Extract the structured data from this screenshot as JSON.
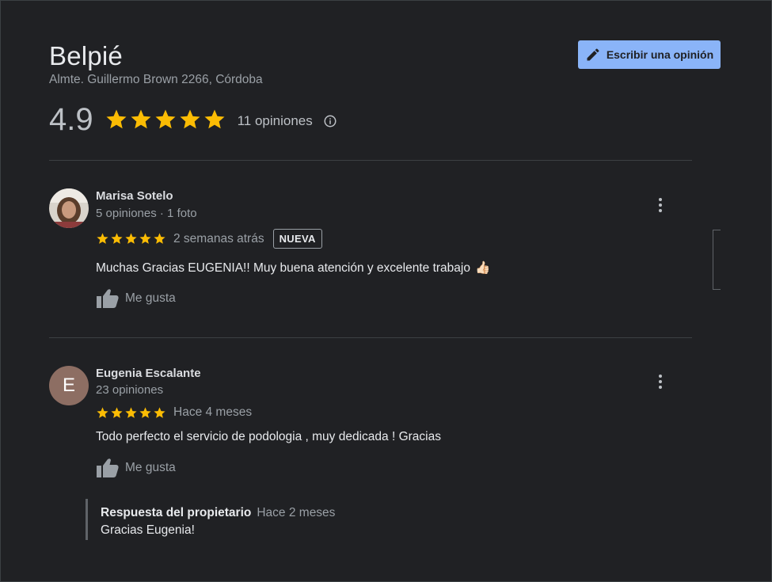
{
  "business": {
    "name": "Belpié",
    "address": "Almte. Guillermo Brown 2266, Córdoba",
    "write_review_label": "Escribir una opinión",
    "rating": "4.9",
    "stars": 5,
    "review_count_label": "11 opiniones"
  },
  "colors": {
    "star": "#fbbc04",
    "accent_button": "#8ab4f8",
    "background": "#202124"
  },
  "reviews": [
    {
      "author": "Marisa Sotelo",
      "meta": "5 opiniones · 1 foto",
      "stars": 5,
      "when": "2 semanas atrás",
      "badge": "NUEVA",
      "text": "Muchas Gracias EUGENIA!! Muy buena atención y excelente trabajo",
      "emoji": "👍🏻",
      "like_label": "Me gusta"
    },
    {
      "author": "Eugenia Escalante",
      "avatar_letter": "E",
      "meta": "23 opiniones",
      "stars": 5,
      "when": "Hace 4 meses",
      "text": "Todo perfecto el servicio de podologia , muy dedicada ! Gracias",
      "like_label": "Me gusta",
      "owner_reply": {
        "label": "Respuesta del propietario",
        "when": "Hace 2 meses",
        "text": "Gracias Eugenia!"
      }
    }
  ],
  "icons": {
    "write": "pencil-icon",
    "info": "info-icon",
    "like": "thumbs-up-icon",
    "more": "more-vert-icon",
    "star": "star-icon"
  }
}
